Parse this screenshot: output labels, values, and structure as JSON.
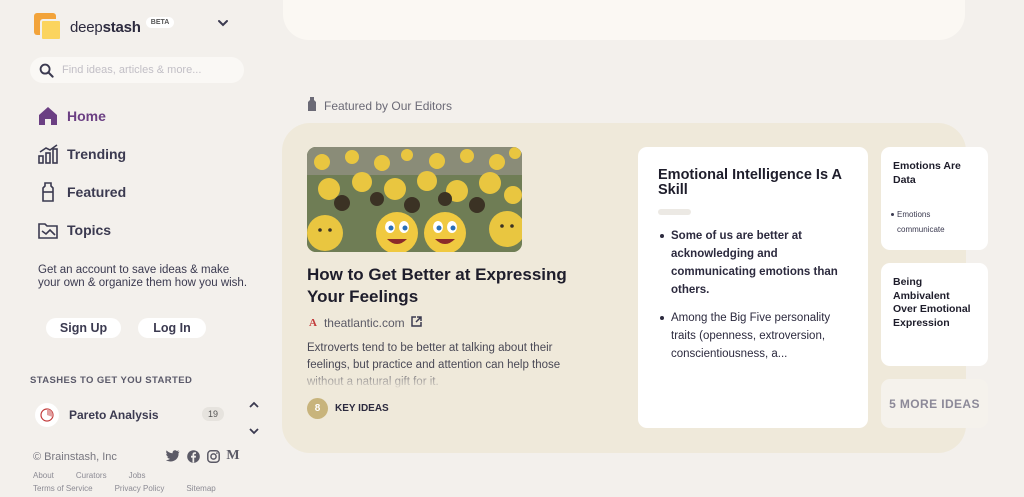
{
  "brand": {
    "name_light": "deep",
    "name_bold": "stash",
    "badge": "BETA"
  },
  "search": {
    "placeholder": "Find ideas, articles & more..."
  },
  "nav": [
    {
      "label": "Home",
      "icon": "home-icon",
      "active": true
    },
    {
      "label": "Trending",
      "icon": "trending-icon"
    },
    {
      "label": "Featured",
      "icon": "featured-icon"
    },
    {
      "label": "Topics",
      "icon": "topics-icon"
    }
  ],
  "promo": {
    "text": "Get an account to save ideas & make your own & organize them how you wish.",
    "signup_label": "Sign Up",
    "login_label": "Log In"
  },
  "stashes": {
    "heading": "STASHES TO GET YOU STARTED",
    "items": [
      {
        "name": "Pareto Analysis",
        "count": "19"
      }
    ]
  },
  "footer": {
    "copyright": "© Brainstash, Inc",
    "links_row1": [
      "About",
      "Curators",
      "Jobs"
    ],
    "links_row2": [
      "Terms of Service",
      "Privacy Policy",
      "Sitemap"
    ]
  },
  "featured": {
    "label": "Featured by Our Editors",
    "article": {
      "title": "How to Get Better at Expressing Your Feelings",
      "source": "theatlantic.com",
      "description": "Extroverts tend to be better at talking about their feelings, but practice and attention can help those without a natural gift for it.",
      "key_ideas_count": "8",
      "key_ideas_label": "KEY IDEAS"
    },
    "idea_card": {
      "title": "Emotional Intelligence Is A Skill",
      "bullets": [
        "Some of us are better at acknowledging and communicating emotions than others.",
        "Among the Big Five personality traits (openness, extroversion, conscientiousness, a..."
      ]
    },
    "mini_cards": [
      {
        "title": "Emotions Are Data",
        "bullet": "Emotions communicate"
      },
      {
        "title": "Being Ambivalent Over Emotional Expression"
      }
    ],
    "more_label": "5 MORE IDEAS"
  },
  "colors": {
    "accent": "#6b3f83",
    "panel": "#efe9da",
    "background": "#f3f0ec",
    "key_ideas_badge": "#c8b47c"
  }
}
